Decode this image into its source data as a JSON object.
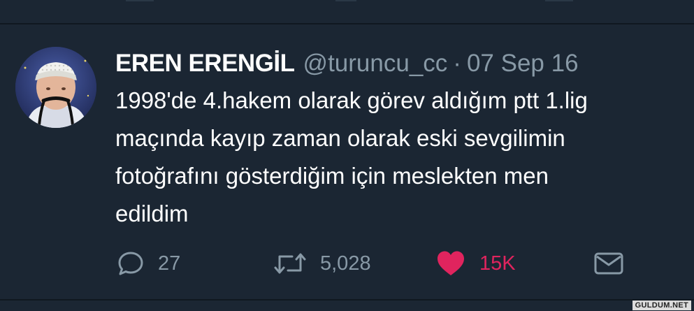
{
  "tweet": {
    "display_name": "EREN ERENGİL",
    "handle": "@turuncu_cc",
    "separator": "·",
    "date": "07 Sep 16",
    "text": "1998'de 4.hakem olarak görev aldığım ptt 1.lig\nmaçında kayıp zaman olarak eski sevgilimin\nfotoğrafını gösterdiğim için meslekten men\nedildim",
    "actions": {
      "reply": {
        "icon": "reply-icon",
        "count": "27"
      },
      "retweet": {
        "icon": "retweet-icon",
        "count": "5,028"
      },
      "like": {
        "icon": "heart-icon",
        "count": "15K",
        "active": true
      },
      "message": {
        "icon": "mail-icon"
      }
    }
  },
  "colors": {
    "background": "#1b2633",
    "secondary_text": "#8899a6",
    "like": "#e0245e",
    "divider": "#101820"
  },
  "watermark": "GULDUM.NET"
}
